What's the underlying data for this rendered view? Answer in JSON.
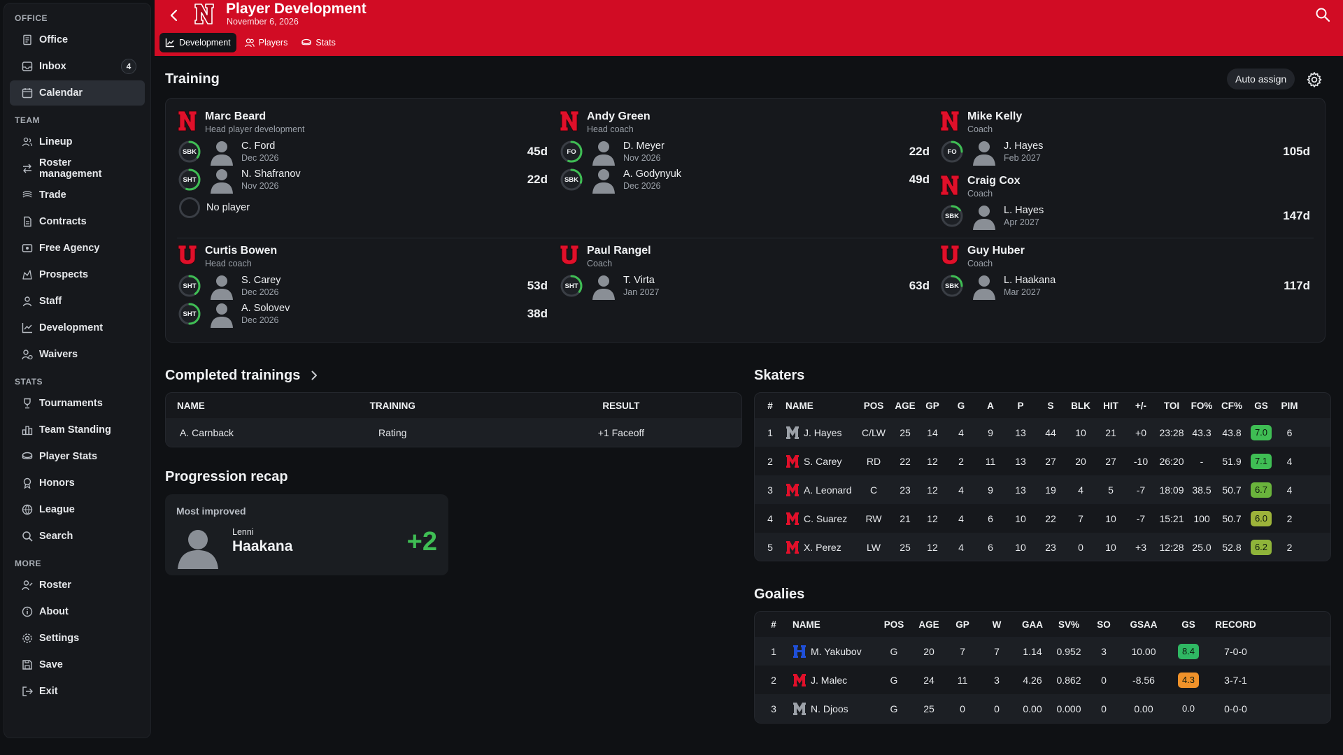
{
  "sidebar": {
    "sections": [
      {
        "title": "OFFICE",
        "items": [
          {
            "label": "Office",
            "icon": "office-icon"
          },
          {
            "label": "Inbox",
            "icon": "inbox-icon",
            "badge": "4"
          },
          {
            "label": "Calendar",
            "icon": "calendar-icon",
            "active": true
          }
        ]
      },
      {
        "title": "TEAM",
        "items": [
          {
            "label": "Lineup",
            "icon": "lineup-icon"
          },
          {
            "label": "Roster management",
            "icon": "roster-management-icon"
          },
          {
            "label": "Trade",
            "icon": "trade-icon"
          },
          {
            "label": "Contracts",
            "icon": "contracts-icon"
          },
          {
            "label": "Free Agency",
            "icon": "free-agency-icon"
          },
          {
            "label": "Prospects",
            "icon": "prospects-icon"
          },
          {
            "label": "Staff",
            "icon": "staff-icon"
          },
          {
            "label": "Development",
            "icon": "development-icon"
          },
          {
            "label": "Waivers",
            "icon": "waivers-icon"
          }
        ]
      },
      {
        "title": "STATS",
        "items": [
          {
            "label": "Tournaments",
            "icon": "tournaments-icon"
          },
          {
            "label": "Team Standing",
            "icon": "team-standing-icon"
          },
          {
            "label": "Player Stats",
            "icon": "player-stats-icon"
          },
          {
            "label": "Honors",
            "icon": "honors-icon"
          },
          {
            "label": "League",
            "icon": "league-icon"
          },
          {
            "label": "Search",
            "icon": "search-icon"
          }
        ]
      },
      {
        "title": "MORE",
        "items": [
          {
            "label": "Roster",
            "icon": "roster-icon"
          },
          {
            "label": "About",
            "icon": "about-icon"
          },
          {
            "label": "Settings",
            "icon": "settings-icon"
          },
          {
            "label": "Save",
            "icon": "save-icon"
          },
          {
            "label": "Exit",
            "icon": "exit-icon"
          }
        ]
      }
    ]
  },
  "header": {
    "title": "Player Development",
    "date": "November 6, 2026",
    "brand_color": "#d10c24",
    "tabs": [
      {
        "label": "Development",
        "icon": "chart-icon",
        "active": true
      },
      {
        "label": "Players",
        "icon": "players-icon"
      },
      {
        "label": "Stats",
        "icon": "stats-icon"
      }
    ]
  },
  "training": {
    "title": "Training",
    "auto_assign_label": "Auto assign",
    "no_player_label": "No player",
    "coaches": [
      {
        "logo": "N",
        "name": "Marc Beard",
        "role": "Head player development",
        "players": [
          {
            "skill": "SBK",
            "name": "C. Ford",
            "date": "Dec 2026",
            "days": "45d",
            "progress": 0.35
          },
          {
            "skill": "SHT",
            "name": "N. Shafranov",
            "date": "Nov 2026",
            "days": "22d",
            "progress": 0.55
          }
        ],
        "empty_slot": true
      },
      {
        "logo": "N",
        "name": "Andy Green",
        "role": "Head coach",
        "players": [
          {
            "skill": "FO",
            "name": "D. Meyer",
            "date": "Nov 2026",
            "days": "22d",
            "progress": 0.55
          },
          {
            "skill": "SBK",
            "name": "A. Godynyuk",
            "date": "Dec 2026",
            "days": "49d",
            "progress": 0.3
          }
        ]
      },
      {
        "logo": "N",
        "name": "Mike Kelly",
        "role": "Coach",
        "players": [
          {
            "skill": "FO",
            "name": "J. Hayes",
            "date": "Feb 2027",
            "days": "105d",
            "progress": 0.25
          }
        ]
      },
      {
        "logo": "N",
        "name": "Craig Cox",
        "role": "Coach",
        "players": [
          {
            "skill": "SBK",
            "name": "L. Hayes",
            "date": "Apr 2027",
            "days": "147d",
            "progress": 0.15
          }
        ]
      },
      {
        "logo": "U",
        "name": "Curtis Bowen",
        "role": "Head coach",
        "players": [
          {
            "skill": "SHT",
            "name": "S. Carey",
            "date": "Dec 2026",
            "days": "53d",
            "progress": 0.4
          },
          {
            "skill": "SHT",
            "name": "A. Solovev",
            "date": "Dec 2026",
            "days": "38d",
            "progress": 0.5
          }
        ]
      },
      {
        "logo": "U",
        "name": "Paul Rangel",
        "role": "Coach",
        "players": [
          {
            "skill": "SHT",
            "name": "T. Virta",
            "date": "Jan 2027",
            "days": "63d",
            "progress": 0.35
          }
        ]
      },
      {
        "logo": "U",
        "name": "Guy Huber",
        "role": "Coach",
        "players": [
          {
            "skill": "SBK",
            "name": "L. Haakana",
            "date": "Mar 2027",
            "days": "117d",
            "progress": 0.25
          }
        ]
      }
    ]
  },
  "completed": {
    "title": "Completed trainings",
    "columns": [
      "NAME",
      "TRAINING",
      "RESULT"
    ],
    "rows": [
      [
        "A. Carnback",
        "Rating",
        "+1 Faceoff"
      ]
    ]
  },
  "recap": {
    "title": "Progression recap",
    "label": "Most improved",
    "first_name": "Lenni",
    "last_name": "Haakana",
    "delta": "+2"
  },
  "skaters": {
    "title": "Skaters",
    "columns": [
      "#",
      "NAME",
      "POS",
      "AGE",
      "GP",
      "G",
      "A",
      "P",
      "S",
      "BLK",
      "HIT",
      "+/-",
      "TOI",
      "FO%",
      "CF%",
      "GS",
      "PIM"
    ],
    "rows": [
      {
        "n": "1",
        "logo": "M-gray",
        "name": "J. Hayes",
        "pos": "C/LW",
        "age": "25",
        "gp": "14",
        "g": "4",
        "a": "9",
        "p": "13",
        "s": "44",
        "blk": "10",
        "hit": "21",
        "pm": "+0",
        "toi": "23:28",
        "fo": "43.3",
        "cf": "43.8",
        "gs": "7.0",
        "gs_color": "#3fbe54",
        "pim": "6"
      },
      {
        "n": "2",
        "logo": "M-red",
        "name": "S. Carey",
        "pos": "RD",
        "age": "22",
        "gp": "12",
        "g": "2",
        "a": "11",
        "p": "13",
        "s": "27",
        "blk": "20",
        "hit": "27",
        "pm": "-10",
        "toi": "26:20",
        "fo": "-",
        "cf": "51.9",
        "gs": "7.1",
        "gs_color": "#3fbe54",
        "pim": "4"
      },
      {
        "n": "3",
        "logo": "M-red",
        "name": "A. Leonard",
        "pos": "C",
        "age": "23",
        "gp": "12",
        "g": "4",
        "a": "9",
        "p": "13",
        "s": "19",
        "blk": "4",
        "hit": "5",
        "pm": "-7",
        "toi": "18:09",
        "fo": "38.5",
        "cf": "50.7",
        "gs": "6.7",
        "gs_color": "#6ab43c",
        "pim": "4"
      },
      {
        "n": "4",
        "logo": "M-red",
        "name": "C. Suarez",
        "pos": "RW",
        "age": "21",
        "gp": "12",
        "g": "4",
        "a": "6",
        "p": "10",
        "s": "22",
        "blk": "7",
        "hit": "10",
        "pm": "-7",
        "toi": "15:21",
        "fo": "100",
        "cf": "50.7",
        "gs": "6.0",
        "gs_color": "#9db33a",
        "pim": "2"
      },
      {
        "n": "5",
        "logo": "M-red",
        "name": "X. Perez",
        "pos": "LW",
        "age": "25",
        "gp": "12",
        "g": "4",
        "a": "6",
        "p": "10",
        "s": "23",
        "blk": "0",
        "hit": "10",
        "pm": "+3",
        "toi": "12:28",
        "fo": "25.0",
        "cf": "52.8",
        "gs": "6.2",
        "gs_color": "#8fb43a",
        "pim": "2"
      }
    ]
  },
  "goalies": {
    "title": "Goalies",
    "columns": [
      "#",
      "NAME",
      "POS",
      "AGE",
      "GP",
      "W",
      "GAA",
      "SV%",
      "SO",
      "GSAA",
      "GS",
      "RECORD"
    ],
    "rows": [
      {
        "n": "1",
        "logo": "H-blue",
        "name": "M. Yakubov",
        "pos": "G",
        "age": "20",
        "gp": "7",
        "w": "7",
        "gaa": "1.14",
        "sv": "0.952",
        "so": "3",
        "gsaa": "10.00",
        "gs": "8.4",
        "gs_color": "#2fb863",
        "record": "7-0-0"
      },
      {
        "n": "2",
        "logo": "M-red",
        "name": "J. Malec",
        "pos": "G",
        "age": "24",
        "gp": "11",
        "w": "3",
        "gaa": "4.26",
        "sv": "0.862",
        "so": "0",
        "gsaa": "-8.56",
        "gs": "4.3",
        "gs_color": "#f0922a",
        "record": "3-7-1"
      },
      {
        "n": "3",
        "logo": "M-gray",
        "name": "N. Djoos",
        "pos": "G",
        "age": "25",
        "gp": "0",
        "w": "0",
        "gaa": "0.00",
        "sv": "0.000",
        "so": "0",
        "gsaa": "0.00",
        "gs": "0.0",
        "gs_color": "",
        "record": "0-0-0"
      }
    ]
  }
}
